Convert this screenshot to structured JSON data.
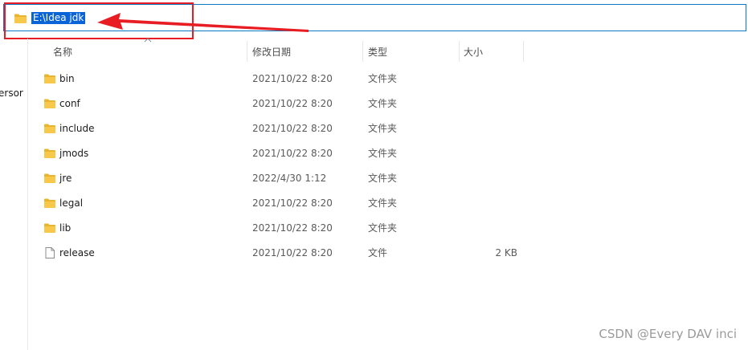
{
  "address_bar": {
    "path": "E:\\Idea jdk",
    "icon": "folder-icon"
  },
  "nav": {
    "cut_label": "ersor"
  },
  "columns": {
    "name": "名称",
    "date": "修改日期",
    "type": "类型",
    "size": "大小"
  },
  "sort": {
    "column": "name",
    "direction": "ascending"
  },
  "files": [
    {
      "name": "bin",
      "date": "2021/10/22 8:20",
      "type": "文件夹",
      "size": "",
      "icon": "folder-icon"
    },
    {
      "name": "conf",
      "date": "2021/10/22 8:20",
      "type": "文件夹",
      "size": "",
      "icon": "folder-icon"
    },
    {
      "name": "include",
      "date": "2021/10/22 8:20",
      "type": "文件夹",
      "size": "",
      "icon": "folder-icon"
    },
    {
      "name": "jmods",
      "date": "2021/10/22 8:20",
      "type": "文件夹",
      "size": "",
      "icon": "folder-icon"
    },
    {
      "name": "jre",
      "date": "2022/4/30 1:12",
      "type": "文件夹",
      "size": "",
      "icon": "folder-icon"
    },
    {
      "name": "legal",
      "date": "2021/10/22 8:20",
      "type": "文件夹",
      "size": "",
      "icon": "folder-icon"
    },
    {
      "name": "lib",
      "date": "2021/10/22 8:20",
      "type": "文件夹",
      "size": "",
      "icon": "folder-icon"
    },
    {
      "name": "release",
      "date": "2021/10/22 8:20",
      "type": "文件",
      "size": "2 KB",
      "icon": "file-icon"
    }
  ],
  "colors": {
    "selection": "#0a64d8",
    "address_border": "#0b79c4",
    "annotation": "#e81d24",
    "folder": "#f7c84a"
  },
  "watermark": "CSDN @Every DAV inci"
}
